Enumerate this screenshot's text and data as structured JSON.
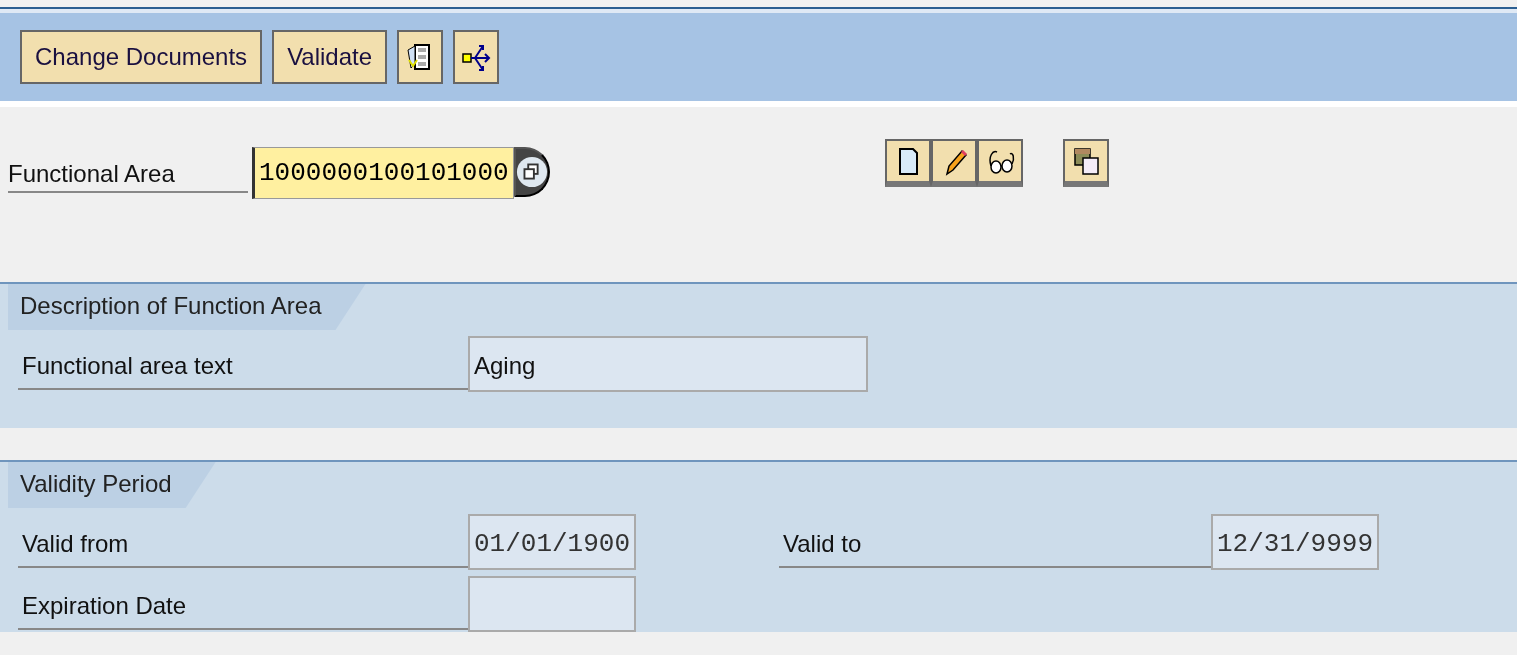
{
  "toolbar": {
    "buttons": [
      "Change Documents",
      "Validate"
    ]
  },
  "header_field": {
    "label": "Functional Area",
    "value": "1000000100101000",
    "focused": true
  },
  "sections": [
    {
      "title": "Description of Function Area",
      "rows": [
        [
          {
            "label": "Functional area text",
            "value": "Aging"
          }
        ]
      ]
    },
    {
      "title": "Validity Period",
      "rows": [
        [
          {
            "label": "Valid from",
            "value": "01/01/1900"
          },
          {
            "label": "Valid to",
            "value": "12/31/9999"
          }
        ],
        [
          {
            "label": "Expiration Date"
          }
        ]
      ]
    }
  ]
}
